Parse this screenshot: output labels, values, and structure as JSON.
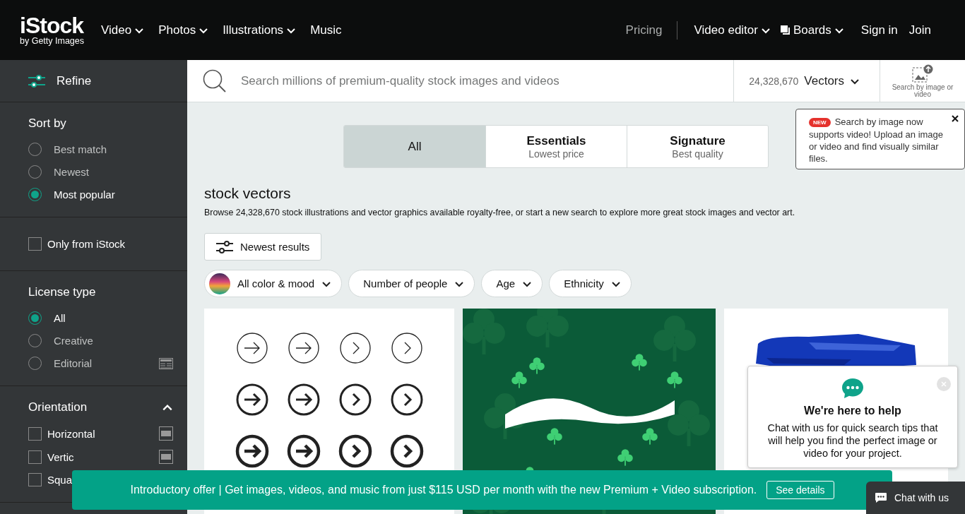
{
  "header": {
    "logo": {
      "name": "iStock",
      "tagline": "by Getty Images"
    },
    "nav": [
      {
        "label": "Video",
        "dropdown": true
      },
      {
        "label": "Photos",
        "dropdown": true
      },
      {
        "label": "Illustrations",
        "dropdown": true
      },
      {
        "label": "Music",
        "dropdown": false
      }
    ],
    "right": [
      {
        "label": "Pricing",
        "kind": "muted"
      },
      {
        "label": "Video editor",
        "kind": "dropdown"
      },
      {
        "label": "Boards",
        "kind": "boards"
      },
      {
        "label": "Sign in",
        "kind": "link"
      },
      {
        "label": "Join",
        "kind": "link"
      }
    ]
  },
  "sidebar": {
    "refine": "Refine",
    "sections": [
      {
        "kind": "radio",
        "title": "Sort by",
        "options": [
          {
            "label": "Best match",
            "selected": false
          },
          {
            "label": "Newest",
            "selected": false
          },
          {
            "label": "Most popular",
            "selected": true
          }
        ]
      },
      {
        "kind": "checkbox",
        "options": [
          {
            "label": "Only from iStock",
            "checked": false
          }
        ]
      },
      {
        "kind": "radio",
        "title": "License type",
        "options": [
          {
            "label": "All",
            "selected": true
          },
          {
            "label": "Creative",
            "selected": false
          },
          {
            "label": "Editorial",
            "selected": false,
            "kind": "icon"
          }
        ]
      },
      {
        "kind": "checkbox",
        "title": "Orientation",
        "expanded": true,
        "options": [
          {
            "label": "Horizontal",
            "checked": false,
            "kind": "icon"
          },
          {
            "label": "Vertic",
            "checked": false,
            "kind": "icon"
          },
          {
            "label": "Squa",
            "checked": false
          }
        ]
      }
    ]
  },
  "search": {
    "placeholder": "Search millions of premium-quality stock images and videos",
    "count": "24,328,670",
    "type": "Vectors",
    "image_search": "Search by image or video"
  },
  "tooltip": {
    "badge": "NEW",
    "text": "Search by image now supports video! Upload an image or video and find visually similar files."
  },
  "tabs": [
    {
      "title": "All",
      "selected": true
    },
    {
      "title": "Essentials",
      "subtitle": "Lowest price",
      "selected": false
    },
    {
      "title": "Signature",
      "subtitle": "Best quality",
      "selected": false
    }
  ],
  "heading": "stock vectors",
  "description": "Browse 24,328,670 stock illustrations and vector graphics available royalty-free, or start a new search to explore more great stock images and vector art.",
  "newest_button": "Newest results",
  "filters": [
    {
      "label": "All color & mood",
      "kind": "swatch"
    },
    {
      "label": "Number of people",
      "kind": "plain"
    },
    {
      "label": "Age",
      "kind": "plain"
    },
    {
      "label": "Ethnicity",
      "kind": "plain"
    }
  ],
  "banner": {
    "text": "Introductory offer | Get images, videos, and music from just $115 USD per month with the new Premium + Video subscription.",
    "button": "See details"
  },
  "chat_popup": {
    "title": "We're here to help",
    "text": "Chat with us for quick search tips that will help you find the perfect image or video for your project."
  },
  "chat_button": "Chat with us"
}
